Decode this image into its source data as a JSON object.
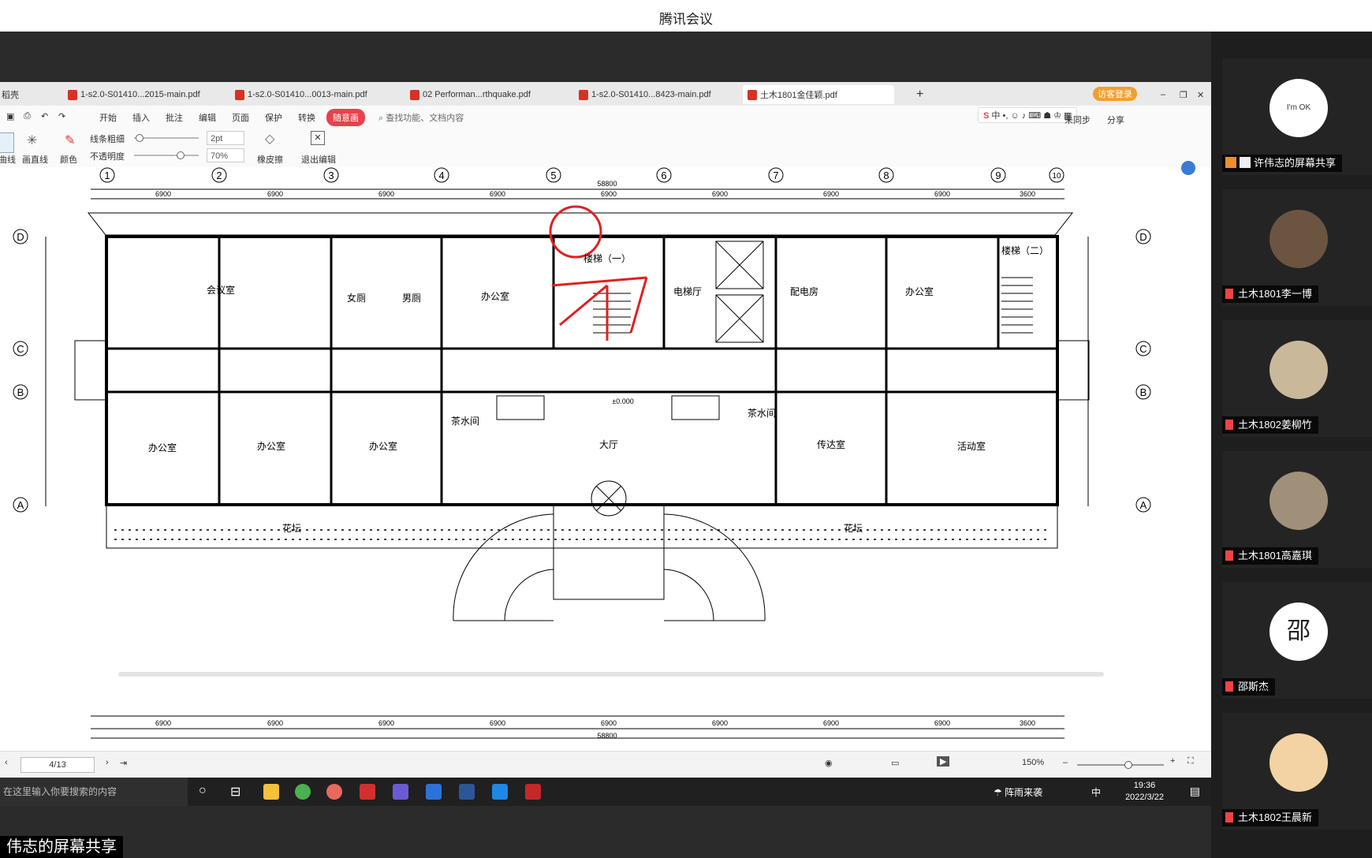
{
  "app": {
    "title": "腾讯会议"
  },
  "share_label": "伟志的屏幕共享",
  "pdf_viewer": {
    "tabs": [
      {
        "label": "稻壳"
      },
      {
        "label": "1-s2.0-S01410...2015-main.pdf"
      },
      {
        "label": "1-s2.0-S01410...0013-main.pdf"
      },
      {
        "label": "02 Performan...rthquake.pdf"
      },
      {
        "label": "1-s2.0-S01410...8423-main.pdf"
      },
      {
        "label": "土木1801金佳颖.pdf"
      }
    ],
    "visitor_badge": "访客登录",
    "menus": [
      "开始",
      "插入",
      "批注",
      "编辑",
      "页面",
      "保护",
      "转换"
    ],
    "highlight_menu": "随意画",
    "search_placeholder": "查找功能、文档内容",
    "sync_label": "未同步",
    "share_label": "分享",
    "tools": {
      "pen": "曲线",
      "straight": "画直线",
      "color": "颜色",
      "line_width_label": "线条粗细",
      "opacity_label": "不透明度",
      "line_width_value": "2pt",
      "opacity_value": "70%",
      "eraser": "橡皮擦",
      "exit": "退出编辑"
    },
    "ime_label": "中",
    "page_indicator": "4/13",
    "zoom": "150%",
    "drawing": {
      "axes_top": [
        "1",
        "2",
        "3",
        "4",
        "5",
        "6",
        "7",
        "8",
        "9",
        "10"
      ],
      "axes_side": [
        "D",
        "C",
        "B",
        "A"
      ],
      "overall_width": "58800",
      "bay": "6900",
      "bay_end": "3600",
      "rooms": [
        "会议室",
        "女厕",
        "男厕",
        "办公室",
        "楼梯（一）",
        "电梯厅",
        "配电房",
        "办公室",
        "楼梯（二）",
        "办公室",
        "办公室",
        "办公室",
        "茶水间",
        "大厅",
        "茶水间",
        "传达室",
        "活动室"
      ],
      "garden": "花坛",
      "elev_hall": "±0.000",
      "section_marks": [
        "1",
        "2"
      ]
    }
  },
  "taskbar": {
    "search_placeholder": "在这里输入你要搜索的内容",
    "weather": "阵雨来袭",
    "ime": "中",
    "time": "19:36",
    "date": "2022/3/22"
  },
  "participants": [
    {
      "name": "许伟志的屏幕共享",
      "avatar": "cloud-avatar",
      "avatar_text": "I'm OK",
      "sharing": true
    },
    {
      "name": "土木1801李一博",
      "avatar": "portrait-avatar"
    },
    {
      "name": "土木1802姜柳竹",
      "avatar": "photo-avatar"
    },
    {
      "name": "土木1801高嘉琪",
      "avatar": "cat-avatar"
    },
    {
      "name": "邵斯杰",
      "avatar": "text-avatar",
      "avatar_text": "邵"
    },
    {
      "name": "土木1802王晨新",
      "avatar": "anime-avatar"
    }
  ]
}
